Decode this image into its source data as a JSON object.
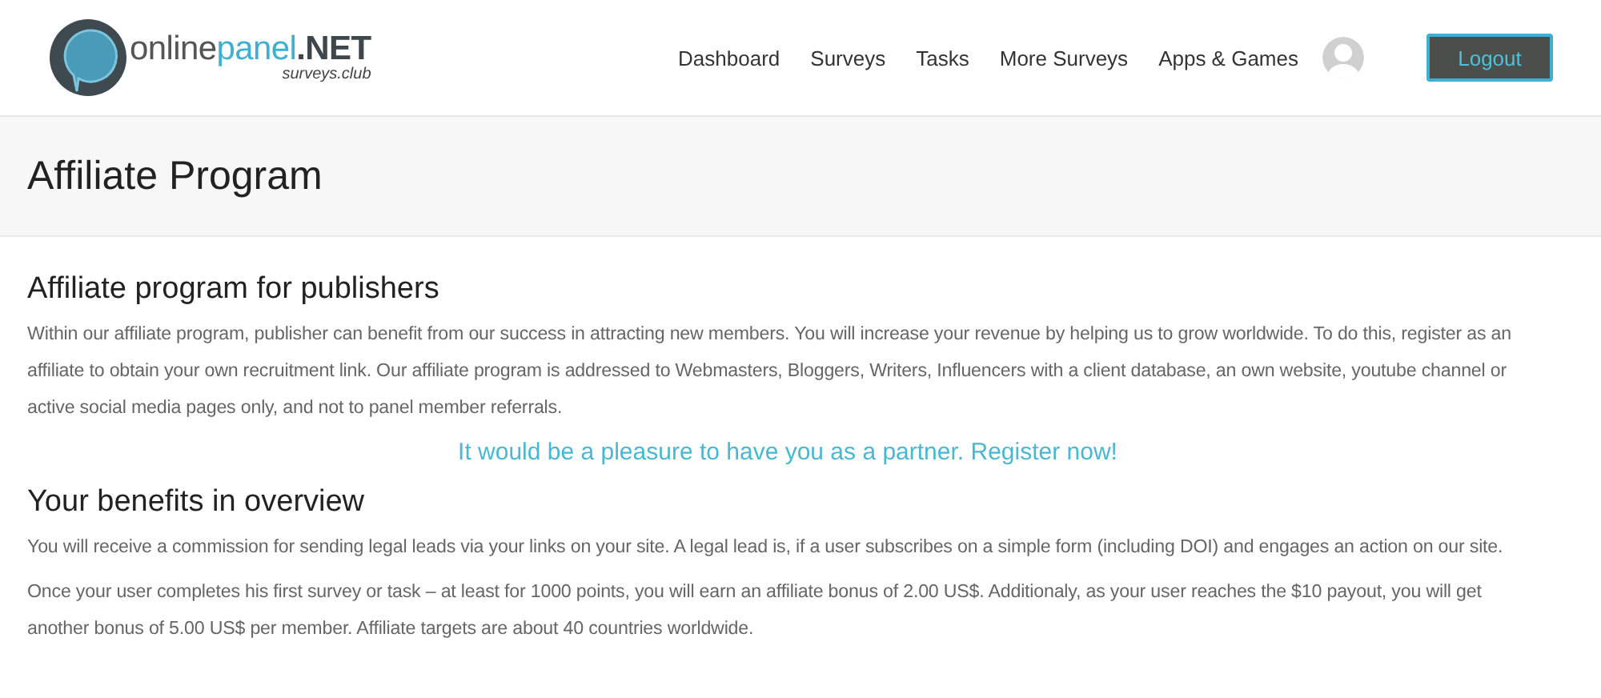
{
  "logo": {
    "name_dark": "online",
    "name_accent": "panel",
    "name_suffix": ".NET",
    "tagline": "surveys.club"
  },
  "nav": [
    {
      "label": "Dashboard"
    },
    {
      "label": "Surveys"
    },
    {
      "label": "Tasks"
    },
    {
      "label": "More Surveys"
    },
    {
      "label": "Apps & Games"
    }
  ],
  "logout_button": "Logout",
  "page_title": "Affiliate Program",
  "sections": [
    {
      "kind": "heading",
      "text": "Affiliate program for publishers"
    },
    {
      "kind": "paragraph",
      "text": "Within our affiliate program, publisher can benefit from our success in attracting new members. You will increase your revenue by helping us to grow worldwide. To do this, register as an affiliate to obtain your own recruitment link. Our affiliate program is addressed to Webmasters, Bloggers, Writers, Influencers with a client database, an own website, youtube channel or active social media pages only, and not to panel member referrals."
    },
    {
      "kind": "link",
      "text": "It would be a pleasure to have you as a partner. Register now!"
    },
    {
      "kind": "heading",
      "text": "Your benefits in overview"
    },
    {
      "kind": "paragraph",
      "text": "You will receive a commission for sending legal leads via your links on your site. A legal lead is, if a user subscribes on a simple form (including DOI) and engages an action on our site."
    },
    {
      "kind": "paragraph",
      "text": "Once your user completes his first survey or task – at least for 1000 points, you will earn an affiliate bonus of 2.00 US$. Additionaly, as your user reaches the $10 payout, you will get another bonus of 5.00 US$ per member. Affiliate targets are about 40 countries worldwide."
    }
  ]
}
